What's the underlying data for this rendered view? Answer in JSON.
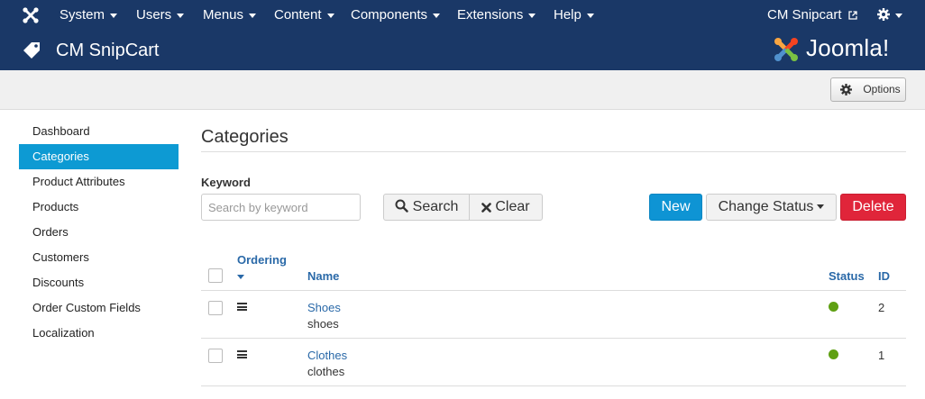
{
  "topnav": {
    "menus": [
      "System",
      "Users",
      "Menus",
      "Content",
      "Components",
      "Extensions",
      "Help"
    ],
    "site_link": "CM Snipcart"
  },
  "header": {
    "title": "CM SnipCart",
    "brand": "Joomla!"
  },
  "toolbar": {
    "options_label": "Options"
  },
  "sidebar": {
    "items": [
      {
        "label": "Dashboard"
      },
      {
        "label": "Categories",
        "active": true
      },
      {
        "label": "Product Attributes"
      },
      {
        "label": "Products"
      },
      {
        "label": "Orders"
      },
      {
        "label": "Customers"
      },
      {
        "label": "Discounts"
      },
      {
        "label": "Order Custom Fields"
      },
      {
        "label": "Localization"
      }
    ]
  },
  "main": {
    "title": "Categories",
    "keyword_label": "Keyword",
    "search_placeholder": "Search by keyword",
    "search_label": "Search",
    "clear_label": "Clear",
    "new_label": "New",
    "change_status_label": "Change Status",
    "delete_label": "Delete"
  },
  "table": {
    "columns": {
      "ordering": "Ordering",
      "name": "Name",
      "status": "Status",
      "id": "ID"
    },
    "rows": [
      {
        "name": "Shoes",
        "alias": "shoes",
        "status": "published",
        "id": "2"
      },
      {
        "name": "Clothes",
        "alias": "clothes",
        "status": "published",
        "id": "1"
      }
    ]
  },
  "colors": {
    "nav_bg": "#1a3867",
    "accent": "#0d9ad3",
    "delete": "#e0253a",
    "link": "#2a69a8",
    "published": "#5fa013"
  },
  "icons": {
    "joomla_menu": "joomla-icon",
    "header": "tag-icon",
    "options": "gear-icon",
    "search": "search-icon",
    "clear": "close-icon",
    "row_handle": "drag-handle-icon",
    "status": "published-icon"
  }
}
